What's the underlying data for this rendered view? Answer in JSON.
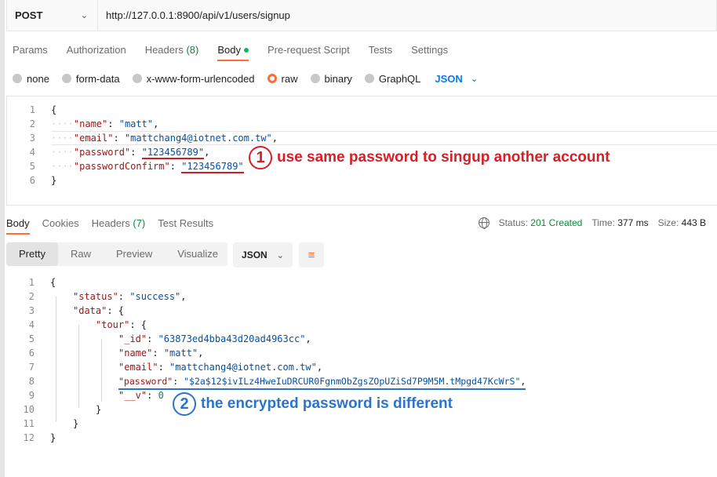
{
  "request": {
    "method": "POST",
    "url": "http://127.0.0.1:8900/api/v1/users/signup"
  },
  "request_tabs": [
    {
      "label": "Params"
    },
    {
      "label": "Authorization"
    },
    {
      "label": "Headers",
      "count": "(8)"
    },
    {
      "label": "Body",
      "active": true
    },
    {
      "label": "Pre-request Script"
    },
    {
      "label": "Tests"
    },
    {
      "label": "Settings"
    }
  ],
  "body_types": [
    "none",
    "form-data",
    "x-www-form-urlencoded",
    "raw",
    "binary",
    "GraphQL"
  ],
  "body_type_selected": "raw",
  "body_format": "JSON",
  "request_body": {
    "line_numbers": [
      "1",
      "2",
      "3",
      "4",
      "5",
      "6"
    ],
    "name_key": "\"name\"",
    "name_val": "\"matt\"",
    "email_key": "\"email\"",
    "email_val": "\"mattchang4@iotnet.com.tw\"",
    "password_key": "\"password\"",
    "password_val": "\"123456789\"",
    "password_confirm_key": "\"passwordConfirm\"",
    "password_confirm_val": "\"123456789\""
  },
  "annotation_1": {
    "number": "1",
    "text": "use same password to singup another account",
    "color": "#d61f26"
  },
  "response_tabs": [
    {
      "label": "Body",
      "active": true
    },
    {
      "label": "Cookies"
    },
    {
      "label": "Headers",
      "count": "(7)"
    },
    {
      "label": "Test Results"
    }
  ],
  "response_meta": {
    "status_label": "Status:",
    "status_value": "201 Created",
    "time_label": "Time:",
    "time_value": "377 ms",
    "size_label": "Size:",
    "size_value": "443 B"
  },
  "view_modes": [
    "Pretty",
    "Raw",
    "Preview",
    "Visualize"
  ],
  "view_mode_selected": "Pretty",
  "response_format": "JSON",
  "response_body": {
    "line_numbers": [
      "1",
      "2",
      "3",
      "4",
      "5",
      "6",
      "7",
      "8",
      "9",
      "10",
      "11",
      "12"
    ],
    "status_key": "\"status\"",
    "status_val": "\"success\"",
    "data_key": "\"data\"",
    "tour_key": "\"tour\"",
    "id_key": "\"_id\"",
    "id_val": "\"63873ed4bba43d20ad4963cc\"",
    "name_key": "\"name\"",
    "name_val": "\"matt\"",
    "email_key": "\"email\"",
    "email_val": "\"mattchang4@iotnet.com.tw\"",
    "password_key": "\"password\"",
    "password_val": "\"$2a$12$ivILz4HweIuDRCUR0FgnmObZgsZOpUZiSd7P9M5M.tMpgd47KcWrS\"",
    "v_key": "\"__v\"",
    "v_val": "0"
  },
  "annotation_2": {
    "number": "2",
    "text": "the encrypted password is different",
    "color": "#2b74c8"
  },
  "colors": {
    "accent": "#ff6c37",
    "json_key": "#a31515",
    "json_string": "#0451a5",
    "json_number": "#098658",
    "status_ok": "#0a8a3a",
    "link_blue": "#097bed"
  }
}
